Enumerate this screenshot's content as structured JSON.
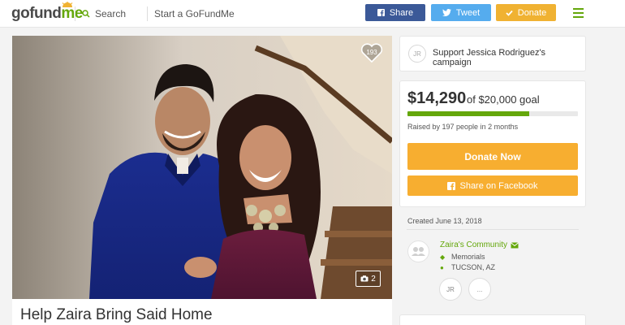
{
  "header": {
    "logo_go": "gofund",
    "logo_me": "me",
    "search_label": "Search",
    "start_label": "Start a GoFundMe",
    "share_label": "Share",
    "tweet_label": "Tweet",
    "donate_label": "Donate"
  },
  "photo": {
    "heart_count": "193",
    "photo_count": "2"
  },
  "campaign": {
    "title": "Help Zaira Bring Said Home"
  },
  "support": {
    "initials": "JR",
    "text": "Support Jessica Rodriguez's campaign"
  },
  "donation": {
    "raised": "$14,290",
    "goal": "of $20,000 goal",
    "progress": 0.7145,
    "raised_by": "Raised by 197 people in 2 months",
    "donate_now": "Donate Now",
    "share_facebook": "Share on Facebook"
  },
  "info": {
    "created": "Created June 13, 2018",
    "community": "Zaira's Community",
    "category": "Memorials",
    "location": "TUCSON, AZ",
    "organizer_initials": "JR",
    "more": "..."
  },
  "colors": {
    "brand_green": "#64a70b",
    "facebook_blue": "#3b5998",
    "twitter_blue": "#55acee",
    "donate_orange": "#f7ae30"
  }
}
